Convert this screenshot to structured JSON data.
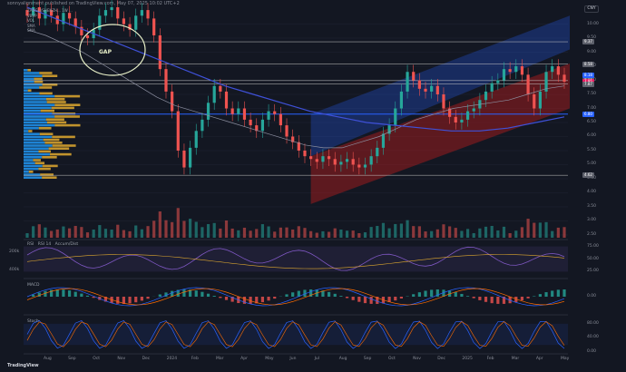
{
  "header": {
    "published": "sonnyalignment published on TradingView.com, May 07, 2025 10:02 UTC+2"
  },
  "legend": {
    "title": "ZANGLI/SHENZH... 1W ...",
    "rows": [
      {
        "label": "VBVP",
        "value": ""
      },
      {
        "label": "VOL",
        "value": ""
      },
      {
        "label": "SMA",
        "value": ""
      },
      {
        "label": "SMA",
        "value": ""
      }
    ]
  },
  "currency_button": "CNY",
  "annotation": {
    "gap_label": "GAP"
  },
  "footer": {
    "brand": "TradingView"
  },
  "colors": {
    "up": "#26a69a",
    "down": "#ef5350",
    "channel_upper": "#2962ff",
    "channel_lower": "#b71c1c",
    "sma_long": "#3f51d8",
    "vbvp_up": "#2196f3",
    "vbvp_down": "#e0a92f",
    "hline": "#c8c8c8",
    "support": "#2962ff"
  },
  "chart_data": [
    {
      "type": "candlestick",
      "title": "",
      "x_ticks": [
        "Aug",
        "Sep",
        "Oct",
        "Nov",
        "Dec",
        "2024",
        "Feb",
        "Mar",
        "Apr",
        "May",
        "Jun",
        "Jul",
        "Aug",
        "Sep",
        "Oct",
        "Nov",
        "Dec",
        "2025",
        "Feb",
        "Mar",
        "Apr",
        "May"
      ],
      "y_ticks": [
        10.0,
        9.5,
        9.0,
        8.5,
        8.0,
        7.5,
        7.0,
        6.5,
        6.0,
        5.5,
        5.0,
        4.5,
        4.0,
        3.5,
        3.0,
        2.5
      ],
      "ylim": [
        2.4,
        10.6
      ],
      "price_labels": [
        {
          "value": "9.37",
          "color": "#5d606b"
        },
        {
          "value": "8.58",
          "color": "#5d606b"
        },
        {
          "value": "8.18",
          "color": "#2962ff"
        },
        {
          "value": "7.99",
          "color": "#5d606b"
        },
        {
          "value": "7.95",
          "color": "#e91e63"
        },
        {
          "value": "7.87",
          "color": "#5d606b"
        },
        {
          "value": "6.80",
          "color": "#2962ff"
        },
        {
          "value": "4.62",
          "color": "#5d606b"
        }
      ],
      "horizontal_lines": [
        9.37,
        8.58,
        7.99,
        7.87,
        4.62
      ],
      "support_line": 6.8,
      "closes": [
        10.3,
        10.6,
        10.2,
        10.5,
        10.3,
        10.0,
        10.4,
        10.2,
        9.9,
        9.6,
        9.5,
        9.8,
        10.3,
        10.5,
        10.6,
        10.2,
        10.0,
        9.8,
        10.3,
        10.5,
        10.2,
        9.6,
        8.4,
        7.6,
        6.9,
        5.5,
        4.9,
        5.6,
        6.2,
        6.6,
        7.2,
        7.8,
        7.6,
        7.0,
        6.8,
        7.0,
        6.6,
        6.4,
        6.2,
        6.6,
        6.9,
        6.8,
        6.4,
        6.0,
        5.8,
        5.5,
        5.3,
        5.2,
        5.1,
        5.3,
        5.2,
        5.0,
        5.1,
        5.2,
        5.0,
        4.9,
        5.0,
        5.3,
        5.6,
        6.1,
        6.4,
        7.0,
        7.6,
        8.3,
        8.0,
        7.7,
        7.6,
        7.8,
        7.5,
        7.0,
        6.7,
        6.5,
        6.6,
        6.9,
        7.0,
        7.3,
        7.6,
        7.9,
        8.0,
        8.4,
        8.3,
        8.5,
        8.2,
        7.5,
        7.0,
        7.6,
        8.3,
        8.5,
        8.2,
        7.95
      ],
      "sma_mid": [
        9.8,
        9.6,
        9.3,
        9.0,
        8.6,
        8.2,
        7.8,
        7.4,
        7.1,
        6.9,
        6.7,
        6.5,
        6.3,
        6.1,
        5.9,
        5.7,
        5.6,
        5.6,
        5.8,
        6.0,
        6.3,
        6.6,
        6.8,
        7.0,
        7.1,
        7.2,
        7.3,
        7.5,
        7.7,
        7.8
      ],
      "sma_long": [
        10.6,
        10.2,
        9.8,
        9.4,
        9.0,
        8.6,
        8.2,
        7.8,
        7.5,
        7.2,
        6.9,
        6.7,
        6.5,
        6.4,
        6.3,
        6.2,
        6.2,
        6.3,
        6.5,
        6.7
      ],
      "channel": {
        "start_x": "Jun 2024",
        "end_x": "May 2025",
        "upper_start": [
          5.3,
          6.8
        ],
        "upper_end": [
          9.1,
          10.3
        ],
        "lower_start": [
          3.6,
          5.3
        ],
        "lower_end": [
          7.0,
          8.6
        ]
      }
    },
    {
      "type": "line",
      "title": "RSI",
      "legend": [
        "RSI 14",
        "Accum/Dist"
      ],
      "y_ticks": [
        75.0,
        50.0,
        25.0
      ],
      "left_ticks": [
        "200k",
        "400k"
      ],
      "ylim": [
        15,
        85
      ]
    },
    {
      "type": "bar",
      "title": "MACD",
      "y_ticks": [
        "0.00"
      ],
      "ylim": [
        -1.2,
        1.0
      ]
    },
    {
      "type": "line",
      "title": "Stoch",
      "y_ticks": [
        80.0,
        40.0,
        0.0
      ],
      "ylim": [
        0,
        100
      ]
    }
  ]
}
